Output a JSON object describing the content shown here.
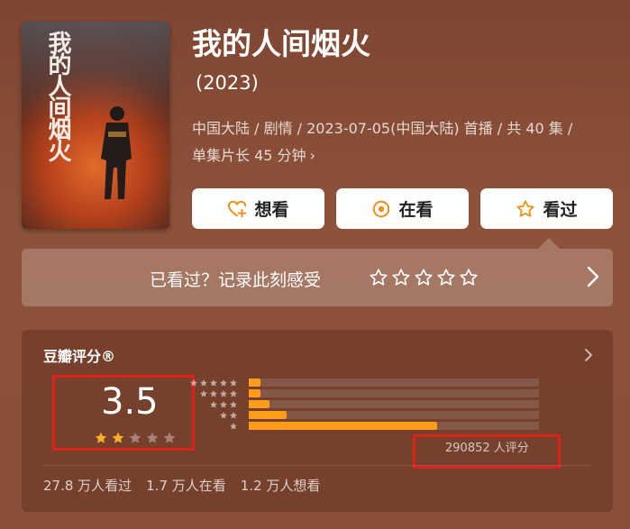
{
  "movie": {
    "poster_title": "我的人间烟火",
    "title": "我的人间烟火",
    "year": "(2023)",
    "meta_line1": "中国大陆 / 剧情 / 2023-07-05(中国大陆) 首播 / 共 40 集 /",
    "meta_line2": "单集片长 45 分钟",
    "meta_arrow": "›"
  },
  "actions": [
    {
      "label": "想看",
      "icon": "heart-plus-icon"
    },
    {
      "label": "在看",
      "icon": "target-icon"
    },
    {
      "label": "看过",
      "icon": "star-outline-icon"
    }
  ],
  "record": {
    "label": "已看过？记录此刻感受",
    "star_count": 5
  },
  "rating": {
    "header": "豆瓣评分®",
    "score": "3.5",
    "stars_filled": 2,
    "stars_total": 5,
    "distribution_fraction": [
      0.04,
      0.04,
      0.07,
      0.13,
      0.65
    ],
    "count_text": "290852 人评分"
  },
  "stats": {
    "watched": "27.8 万人看过",
    "watching": "1.7 万人在看",
    "want": "1.2 万人想看"
  },
  "colors": {
    "accent": "#ff9d1a",
    "highlight_box": "#e0201c",
    "background": "#8a4e38"
  }
}
